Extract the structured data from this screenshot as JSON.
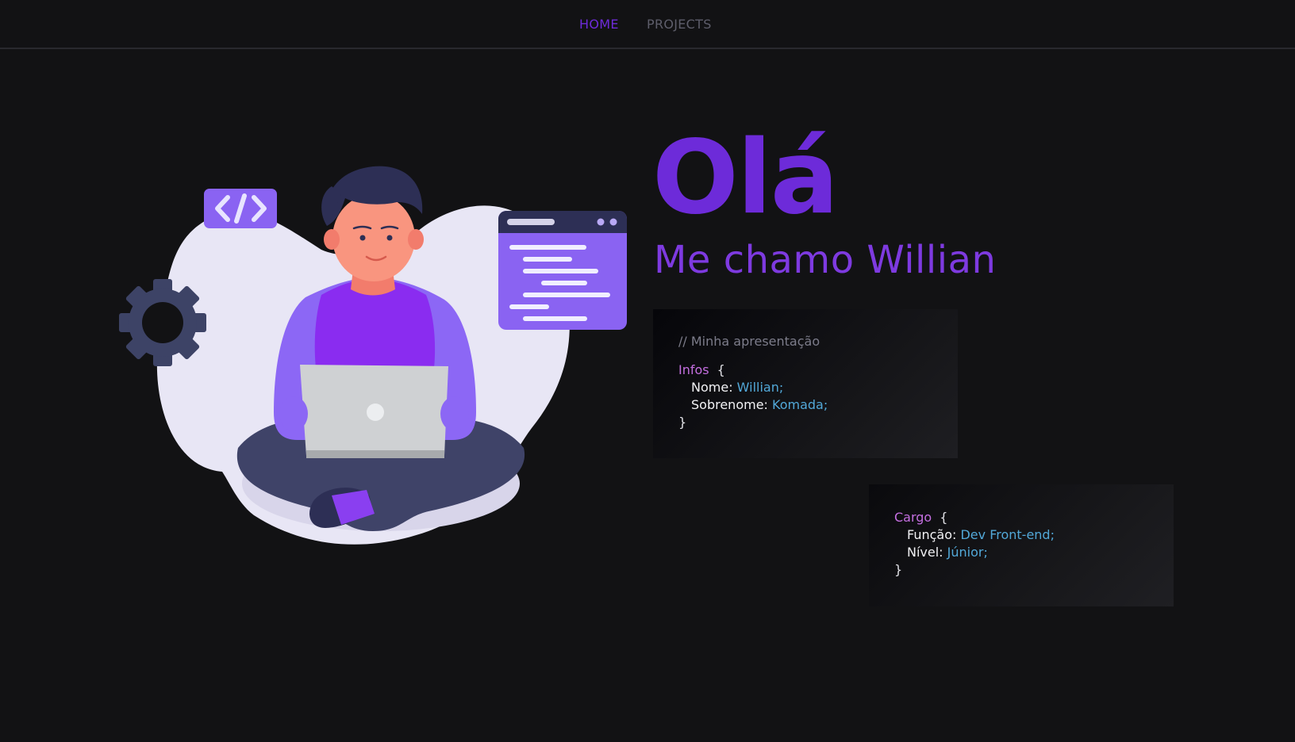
{
  "nav": {
    "home": "HOME",
    "projects": "PROJECTS"
  },
  "hero": {
    "greeting": "Olá",
    "subtitle": "Me chamo Willian"
  },
  "infos_card": {
    "comment": "// Minha apresentação",
    "keyword": "Infos",
    "open_brace": "{",
    "close_brace": "}",
    "fields": [
      {
        "key": "Nome:",
        "value": "Willian;"
      },
      {
        "key": "Sobrenome:",
        "value": "Komada;"
      }
    ]
  },
  "cargo_card": {
    "keyword": "Cargo",
    "open_brace": "{",
    "close_brace": "}",
    "fields": [
      {
        "key": "Função:",
        "value": "Dev Front-end;"
      },
      {
        "key": "Nível:",
        "value": "Júnior;"
      }
    ]
  },
  "colors": {
    "background": "#121214",
    "accent": "#6d2bd9",
    "keyword": "#c46fe0",
    "value": "#52a8d8",
    "muted": "#7c7c8a"
  },
  "illustration": {
    "icons": [
      "code-tag-icon",
      "gear-icon",
      "browser-window-icon",
      "laptop-icon"
    ]
  }
}
